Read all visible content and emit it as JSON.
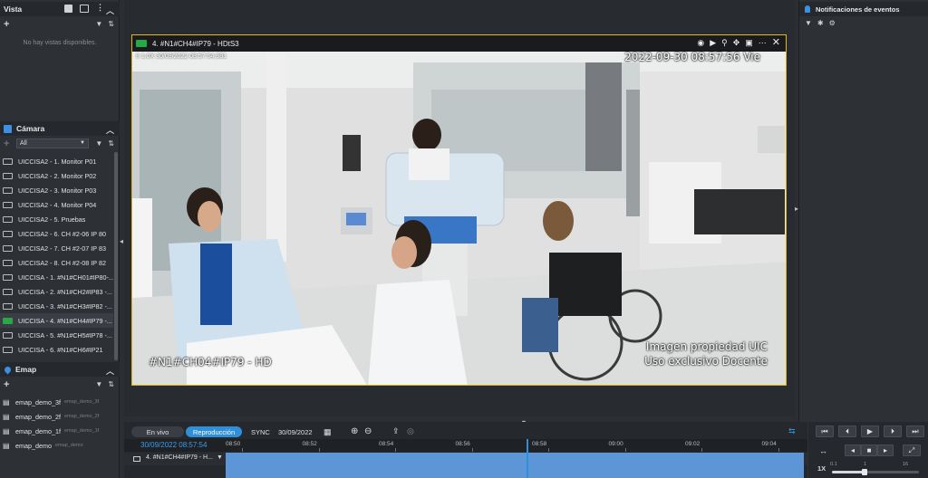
{
  "left_panel": {
    "vista": {
      "title": "Vista",
      "empty_message": "No hay vistas disponibles."
    },
    "camara": {
      "title": "Cámara",
      "filter_value": "All",
      "items": [
        {
          "label": "UICCISA2 - 1. Monitor P01",
          "active": false
        },
        {
          "label": "UICCISA2 - 2. Monitor P02",
          "active": false
        },
        {
          "label": "UICCISA2 - 3. Monitor P03",
          "active": false
        },
        {
          "label": "UICCISA2 - 4. Monitor P04",
          "active": false
        },
        {
          "label": "UICCISA2 - 5. Pruebas",
          "active": false
        },
        {
          "label": "UICCISA2 - 6. CH #2-06  IP 80",
          "active": false
        },
        {
          "label": "UICCISA2 - 7. CH #2-07  IP 83",
          "active": false
        },
        {
          "label": "UICCISA2 - 8. CH #2-08  IP 82",
          "active": false
        },
        {
          "label": "UICCISA - 1. #N1#CH01#IP80-...",
          "active": false
        },
        {
          "label": "UICCISA - 2. #N1#CH2#IP83 -...",
          "active": false
        },
        {
          "label": "UICCISA - 3. #N1#CH3#IP82 -...",
          "active": false
        },
        {
          "label": "UICCISA - 4. #N1#CH4#IP79 -...",
          "active": true
        },
        {
          "label": "UICCISA - 5. #N1#CH5#IP78 -...",
          "active": false
        },
        {
          "label": "UICCISA - 6. #N1#CH6#IP21",
          "active": false
        }
      ]
    },
    "emap": {
      "title": "Emap",
      "items": [
        {
          "label": "emap_demo_3f",
          "sub": "emap_demo_3f"
        },
        {
          "label": "emap_demo_2f",
          "sub": "emap_demo_2f"
        },
        {
          "label": "emap_demo_1f",
          "sub": "emap_demo_1f"
        },
        {
          "label": "emap_demo",
          "sub": "emap_demo"
        }
      ]
    }
  },
  "video": {
    "title": "4. #N1#CH4#IP79 - HDtS3",
    "rec_line": "II 1.0X  30/09/2022 08:57:54.981",
    "osd_timestamp": "2022-09-30  08:57:56  Vie",
    "osd_camera_name": "#N1#CH04#IP79 - HD",
    "watermark_line1": "Imagen propiedad UIC",
    "watermark_line2": "Uso exclusivo Docente",
    "border_color": "#e2b516"
  },
  "right_panel": {
    "title": "Notificaciones de eventos"
  },
  "timeline": {
    "live_label": "En vivo",
    "playback_label": "Reproducción",
    "sync_label": "SYNC",
    "date": "30/09/2022",
    "current_datetime": "30/09/2022 08:57:54",
    "ticks": [
      "08:50",
      "08:52",
      "08:54",
      "08:56",
      "08:58",
      "09:00",
      "09:02",
      "09:04"
    ],
    "track_label": "4. #N1#CH4#IP79 - H...",
    "speed_label": "1X",
    "speed_marks": [
      "0.1",
      "1",
      "16"
    ],
    "accent_color": "#2f8fd8"
  }
}
